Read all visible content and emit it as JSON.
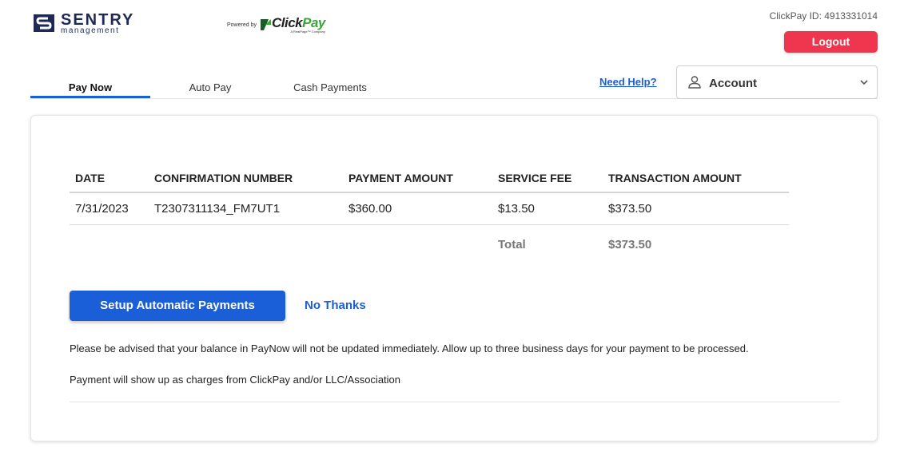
{
  "brand": {
    "sentry_name": "SENTRY",
    "sentry_sub": "management",
    "powered_by": "Powered by",
    "clickpay_click": "Click",
    "clickpay_pay": "Pay",
    "clickpay_sub": "A RealPage™ Company"
  },
  "header": {
    "clickpay_id": "ClickPay ID: 4913331014",
    "logout_label": "Logout"
  },
  "tabs": [
    {
      "label": "Pay Now",
      "active": true
    },
    {
      "label": "Auto Pay",
      "active": false
    },
    {
      "label": "Cash Payments",
      "active": false
    }
  ],
  "need_help": "Need Help?",
  "account": {
    "label": "Account",
    "icon": "user-icon"
  },
  "table": {
    "headers": [
      "DATE",
      "CONFIRMATION NUMBER",
      "PAYMENT AMOUNT",
      "SERVICE FEE",
      "TRANSACTION AMOUNT"
    ],
    "rows": [
      [
        "7/31/2023",
        "T2307311134_FM7UT1",
        "$360.00",
        "$13.50",
        "$373.50"
      ]
    ],
    "total_label": "Total",
    "total_value": "$373.50"
  },
  "actions": {
    "setup_label": "Setup Automatic Payments",
    "no_thanks_label": "No Thanks"
  },
  "notices": {
    "line1": "Please be advised that your balance in PayNow will not be updated immediately. Allow up to three business days for your payment to be processed.",
    "line2": "Payment will show up as charges from ClickPay and/or LLC/Association"
  },
  "colors": {
    "accent": "#1a5ed8",
    "logout": "#f0364e",
    "brand_navy": "#1e2a55",
    "clickpay_green": "#39a935"
  }
}
